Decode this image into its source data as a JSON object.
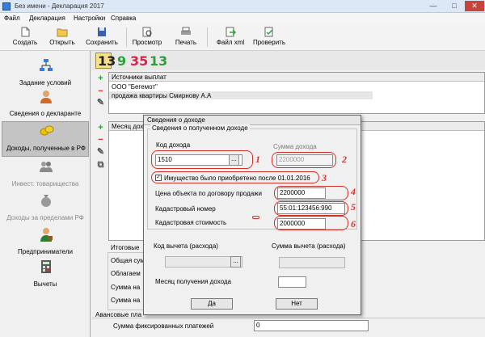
{
  "window": {
    "title": "Без имени - Декларация 2017",
    "btn_min": "—",
    "btn_max": "□",
    "btn_close": "✕"
  },
  "menu": [
    "Файл",
    "Декларация",
    "Настройки",
    "Справка"
  ],
  "toolbar": {
    "create": "Создать",
    "open": "Открыть",
    "save": "Сохранить",
    "preview": "Просмотр",
    "print": "Печать",
    "file_xml": "Файл xml",
    "check": "Проверить"
  },
  "sidebar": {
    "items": [
      {
        "label": "Задание условий",
        "icon": "conditions-icon"
      },
      {
        "label": "Сведения о декларанте",
        "icon": "person-icon"
      },
      {
        "label": "Доходы, полученные в РФ",
        "icon": "coins-icon"
      },
      {
        "label": "Инвест. товарищества",
        "icon": "investors-icon"
      },
      {
        "label": "Доходы за пределами РФ",
        "icon": "moneybag-icon"
      },
      {
        "label": "Предприниматели",
        "icon": "entrepreneur-icon"
      },
      {
        "label": "Вычеты",
        "icon": "calculator-icon"
      }
    ]
  },
  "rate_tabs": [
    "13",
    "9",
    "35",
    "13"
  ],
  "payers": {
    "header": "Источники выплат",
    "rows": [
      "ООО \"Бегемот\"",
      "продажа квартиры Смирнову А.А"
    ]
  },
  "income_panel": {
    "header_partial": "Месяц дох"
  },
  "lower": {
    "itogovye": "Итоговые",
    "obshaya": "Общая сум",
    "oblagaem": "Облагаем",
    "summa_na1": "Сумма на",
    "summa_na2": "Сумма на",
    "avansovye": "Авансовые пла",
    "fixed_payments_label": "Сумма фиксированных платежей",
    "fixed_payments_value": "0"
  },
  "dialog": {
    "title": "Сведения о доходе",
    "group_title": "Сведения о полученном доходе",
    "income_code_label": "Код дохода",
    "income_code_value": "1510",
    "ellipsis": "...",
    "income_sum_label": "Сумма дохода",
    "income_sum_value": "2200000",
    "checkbox_label": "Имущество было приобретено после 01.01.2016",
    "checkbox_checked": true,
    "contract_price_label": "Цена объекта по договору продажи",
    "contract_price_value": "2200000",
    "cadastral_number_label": "Кадастровый номер",
    "cadastral_number_value": "55:01:123456:990",
    "cadastral_value_label": "Кадастровая стоимость",
    "cadastral_value_value": "2000000",
    "deduction_code_label": "Код вычета (расхода)",
    "deduction_sum_label": "Сумма вычета (расхода)",
    "month_label": "Месяц получения дохода",
    "yes": "Да",
    "no": "Нет"
  },
  "annotations": [
    "1",
    "2",
    "3",
    "4",
    "5",
    "6"
  ],
  "colors": {
    "annotation": "#d2302a",
    "num_yellow": "#e8c200",
    "num_green": "#2e9e3a",
    "num_red": "#d8244a"
  }
}
